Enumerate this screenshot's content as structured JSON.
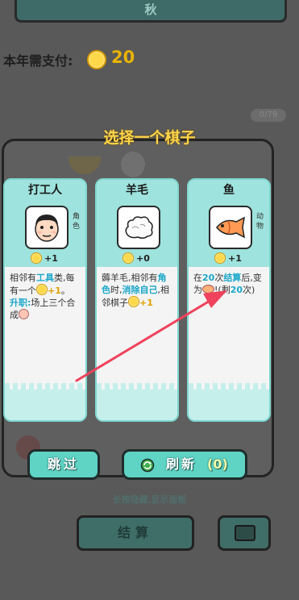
{
  "header": {
    "season": "秋"
  },
  "payment": {
    "label": "本年需支付:",
    "amount": "20"
  },
  "counter": "0/79",
  "dialog": {
    "title": "选择一个棋子"
  },
  "cards": [
    {
      "name": "打工人",
      "tag": "角色",
      "bonus": "+1",
      "desc": {
        "p1": "相邻有",
        "k1": "工具",
        "p2": "类,每有一个",
        "g1": "+1",
        "p3": "。",
        "k2": "升职:",
        "p4": "场上三个合成"
      }
    },
    {
      "name": "羊毛",
      "tag": "",
      "bonus": "+0",
      "desc": {
        "p1": "薅羊毛,相邻有",
        "k1": "角色",
        "p2": "时,",
        "k2": "消除自己",
        "p3": ",相邻棋子",
        "g1": "+1"
      }
    },
    {
      "name": "鱼",
      "tag": "动物",
      "bonus": "+1",
      "desc": {
        "p1": "在",
        "k1": "20",
        "p2": "次",
        "k2": "结算",
        "p3": "后,变为",
        "p4": "!(剩",
        "k3": "20",
        "p5": "次)"
      }
    }
  ],
  "buttons": {
    "skip": "跳过",
    "refresh": "刷新",
    "refresh_count": "(0)",
    "settle": "结算"
  },
  "hint": "长按隐藏,显示面板",
  "colors": {
    "accent": "#5fd3c4",
    "card_header": "#9ee3dd",
    "highlight": "#1aa7c9",
    "coin": "#ffd84a",
    "arrow": "#f0425c"
  }
}
